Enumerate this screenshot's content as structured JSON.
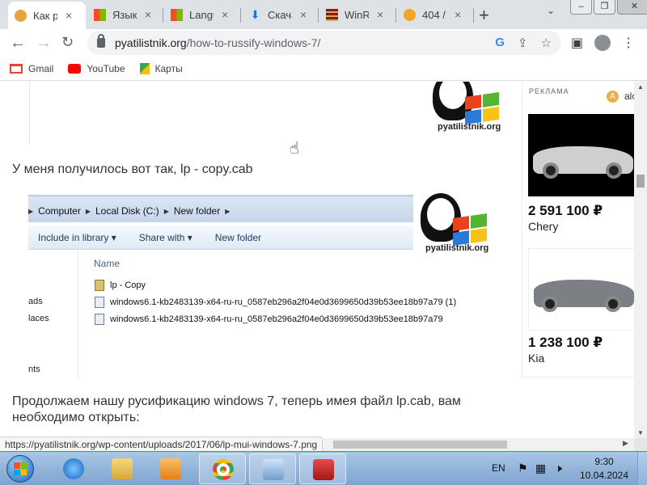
{
  "browser": {
    "tabs": [
      {
        "label": "Как р",
        "icon": "globe-icon",
        "color": "#e8a33d"
      },
      {
        "label": "Языко",
        "icon": "windows-icon",
        "color": "#f25022"
      },
      {
        "label": "Langu",
        "icon": "windows-icon",
        "color": "#f25022"
      },
      {
        "label": "Скача",
        "icon": "download-icon",
        "color": "#1a73e8"
      },
      {
        "label": "WinRa",
        "icon": "winrar-icon",
        "color": "#8b1a1a"
      },
      {
        "label": "404 /",
        "icon": "cloud-icon",
        "color": "#f4a523"
      }
    ],
    "close_glyph": "×",
    "new_tab_glyph": "+",
    "window_buttons": [
      "–",
      "❐",
      "✕"
    ],
    "url_host": "pyatilistnik.org",
    "url_path": "/how-to-russify-windows-7/",
    "bookmarks": [
      {
        "label": "Gmail",
        "icon": "gmail-icon"
      },
      {
        "label": "YouTube",
        "icon": "youtube-icon"
      },
      {
        "label": "Карты",
        "icon": "maps-icon"
      }
    ]
  },
  "article": {
    "watermark": "pyatilistnik.org",
    "para1": "У меня получилось вот так, lp - copy.cab",
    "para2": "Продолжаем нашу русификацию windows 7, теперь имея файл lp.cab, вам необходимо открыть:"
  },
  "explorer": {
    "breadcrumbs": [
      "Computer",
      "Local Disk (C:)",
      "New folder"
    ],
    "commands": [
      "Include in library ▾",
      "Share with ▾",
      "New folder"
    ],
    "nav_items": [
      "ads",
      "laces",
      "nts"
    ],
    "column_header": "Name",
    "files": [
      {
        "name": "lp - Copy",
        "type": "cab"
      },
      {
        "name": "windows6.1-kb2483139-x64-ru-ru_0587eb296a2f04e0d3699650d39b53ee18b97a79 (1)",
        "type": "msu"
      },
      {
        "name": "windows6.1-kb2483139-x64-ru-ru_0587eb296a2f04e0d3699650d39b53ee18b97a79",
        "type": "msu"
      }
    ]
  },
  "ad": {
    "label": "РЕКЛАМА",
    "badge_letter": "A",
    "badge_text": "alc",
    "items": [
      {
        "price": "2 591 100 ₽",
        "brand": "Chery"
      },
      {
        "price": "1 238 100 ₽",
        "brand": "Kia"
      }
    ]
  },
  "status_url": "https://pyatilistnik.org/wp-content/uploads/2017/06/lp-mui-windows-7.png",
  "taskbar": {
    "lang": "EN",
    "time": "9:30",
    "date": "10.04.2024"
  }
}
